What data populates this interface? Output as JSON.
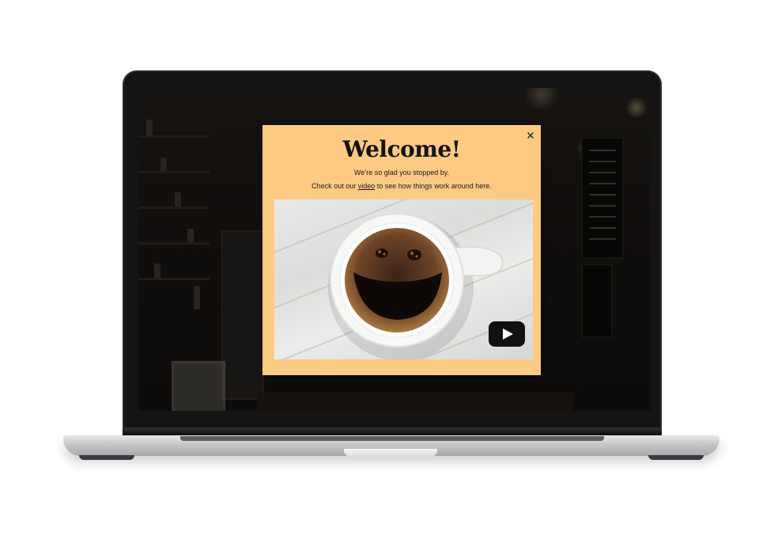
{
  "popup": {
    "title": "Welcome!",
    "subtitle": "We’re so glad you stopped by.",
    "cta_prefix": "Check out our ",
    "cta_link": "video",
    "cta_suffix": " to see how things work around here."
  },
  "colors": {
    "popup_background": "#fdca84",
    "title_text": "#121212",
    "play_button": "#111111",
    "coffee": "#2a1a10",
    "crema": "#9a6a3a"
  },
  "icons": {
    "close": "close-icon",
    "play": "play-icon"
  }
}
